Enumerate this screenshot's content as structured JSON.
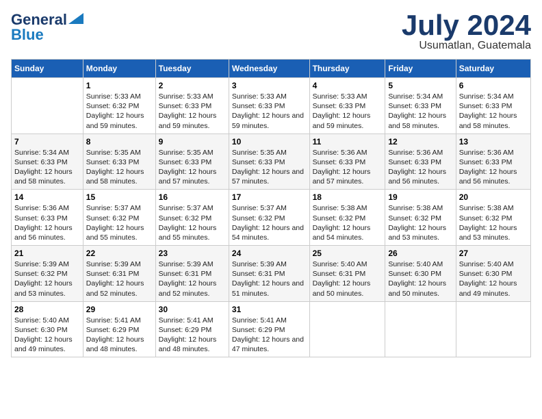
{
  "header": {
    "logo_line1": "General",
    "logo_line2": "Blue",
    "month_year": "July 2024",
    "location": "Usumatlan, Guatemala"
  },
  "days_of_week": [
    "Sunday",
    "Monday",
    "Tuesday",
    "Wednesday",
    "Thursday",
    "Friday",
    "Saturday"
  ],
  "weeks": [
    [
      {
        "day": "",
        "sunrise": "",
        "sunset": "",
        "daylight": ""
      },
      {
        "day": "1",
        "sunrise": "Sunrise: 5:33 AM",
        "sunset": "Sunset: 6:32 PM",
        "daylight": "Daylight: 12 hours and 59 minutes."
      },
      {
        "day": "2",
        "sunrise": "Sunrise: 5:33 AM",
        "sunset": "Sunset: 6:33 PM",
        "daylight": "Daylight: 12 hours and 59 minutes."
      },
      {
        "day": "3",
        "sunrise": "Sunrise: 5:33 AM",
        "sunset": "Sunset: 6:33 PM",
        "daylight": "Daylight: 12 hours and 59 minutes."
      },
      {
        "day": "4",
        "sunrise": "Sunrise: 5:33 AM",
        "sunset": "Sunset: 6:33 PM",
        "daylight": "Daylight: 12 hours and 59 minutes."
      },
      {
        "day": "5",
        "sunrise": "Sunrise: 5:34 AM",
        "sunset": "Sunset: 6:33 PM",
        "daylight": "Daylight: 12 hours and 58 minutes."
      },
      {
        "day": "6",
        "sunrise": "Sunrise: 5:34 AM",
        "sunset": "Sunset: 6:33 PM",
        "daylight": "Daylight: 12 hours and 58 minutes."
      }
    ],
    [
      {
        "day": "7",
        "sunrise": "Sunrise: 5:34 AM",
        "sunset": "Sunset: 6:33 PM",
        "daylight": "Daylight: 12 hours and 58 minutes."
      },
      {
        "day": "8",
        "sunrise": "Sunrise: 5:35 AM",
        "sunset": "Sunset: 6:33 PM",
        "daylight": "Daylight: 12 hours and 58 minutes."
      },
      {
        "day": "9",
        "sunrise": "Sunrise: 5:35 AM",
        "sunset": "Sunset: 6:33 PM",
        "daylight": "Daylight: 12 hours and 57 minutes."
      },
      {
        "day": "10",
        "sunrise": "Sunrise: 5:35 AM",
        "sunset": "Sunset: 6:33 PM",
        "daylight": "Daylight: 12 hours and 57 minutes."
      },
      {
        "day": "11",
        "sunrise": "Sunrise: 5:36 AM",
        "sunset": "Sunset: 6:33 PM",
        "daylight": "Daylight: 12 hours and 57 minutes."
      },
      {
        "day": "12",
        "sunrise": "Sunrise: 5:36 AM",
        "sunset": "Sunset: 6:33 PM",
        "daylight": "Daylight: 12 hours and 56 minutes."
      },
      {
        "day": "13",
        "sunrise": "Sunrise: 5:36 AM",
        "sunset": "Sunset: 6:33 PM",
        "daylight": "Daylight: 12 hours and 56 minutes."
      }
    ],
    [
      {
        "day": "14",
        "sunrise": "Sunrise: 5:36 AM",
        "sunset": "Sunset: 6:33 PM",
        "daylight": "Daylight: 12 hours and 56 minutes."
      },
      {
        "day": "15",
        "sunrise": "Sunrise: 5:37 AM",
        "sunset": "Sunset: 6:32 PM",
        "daylight": "Daylight: 12 hours and 55 minutes."
      },
      {
        "day": "16",
        "sunrise": "Sunrise: 5:37 AM",
        "sunset": "Sunset: 6:32 PM",
        "daylight": "Daylight: 12 hours and 55 minutes."
      },
      {
        "day": "17",
        "sunrise": "Sunrise: 5:37 AM",
        "sunset": "Sunset: 6:32 PM",
        "daylight": "Daylight: 12 hours and 54 minutes."
      },
      {
        "day": "18",
        "sunrise": "Sunrise: 5:38 AM",
        "sunset": "Sunset: 6:32 PM",
        "daylight": "Daylight: 12 hours and 54 minutes."
      },
      {
        "day": "19",
        "sunrise": "Sunrise: 5:38 AM",
        "sunset": "Sunset: 6:32 PM",
        "daylight": "Daylight: 12 hours and 53 minutes."
      },
      {
        "day": "20",
        "sunrise": "Sunrise: 5:38 AM",
        "sunset": "Sunset: 6:32 PM",
        "daylight": "Daylight: 12 hours and 53 minutes."
      }
    ],
    [
      {
        "day": "21",
        "sunrise": "Sunrise: 5:39 AM",
        "sunset": "Sunset: 6:32 PM",
        "daylight": "Daylight: 12 hours and 53 minutes."
      },
      {
        "day": "22",
        "sunrise": "Sunrise: 5:39 AM",
        "sunset": "Sunset: 6:31 PM",
        "daylight": "Daylight: 12 hours and 52 minutes."
      },
      {
        "day": "23",
        "sunrise": "Sunrise: 5:39 AM",
        "sunset": "Sunset: 6:31 PM",
        "daylight": "Daylight: 12 hours and 52 minutes."
      },
      {
        "day": "24",
        "sunrise": "Sunrise: 5:39 AM",
        "sunset": "Sunset: 6:31 PM",
        "daylight": "Daylight: 12 hours and 51 minutes."
      },
      {
        "day": "25",
        "sunrise": "Sunrise: 5:40 AM",
        "sunset": "Sunset: 6:31 PM",
        "daylight": "Daylight: 12 hours and 50 minutes."
      },
      {
        "day": "26",
        "sunrise": "Sunrise: 5:40 AM",
        "sunset": "Sunset: 6:30 PM",
        "daylight": "Daylight: 12 hours and 50 minutes."
      },
      {
        "day": "27",
        "sunrise": "Sunrise: 5:40 AM",
        "sunset": "Sunset: 6:30 PM",
        "daylight": "Daylight: 12 hours and 49 minutes."
      }
    ],
    [
      {
        "day": "28",
        "sunrise": "Sunrise: 5:40 AM",
        "sunset": "Sunset: 6:30 PM",
        "daylight": "Daylight: 12 hours and 49 minutes."
      },
      {
        "day": "29",
        "sunrise": "Sunrise: 5:41 AM",
        "sunset": "Sunset: 6:29 PM",
        "daylight": "Daylight: 12 hours and 48 minutes."
      },
      {
        "day": "30",
        "sunrise": "Sunrise: 5:41 AM",
        "sunset": "Sunset: 6:29 PM",
        "daylight": "Daylight: 12 hours and 48 minutes."
      },
      {
        "day": "31",
        "sunrise": "Sunrise: 5:41 AM",
        "sunset": "Sunset: 6:29 PM",
        "daylight": "Daylight: 12 hours and 47 minutes."
      },
      {
        "day": "",
        "sunrise": "",
        "sunset": "",
        "daylight": ""
      },
      {
        "day": "",
        "sunrise": "",
        "sunset": "",
        "daylight": ""
      },
      {
        "day": "",
        "sunrise": "",
        "sunset": "",
        "daylight": ""
      }
    ]
  ]
}
